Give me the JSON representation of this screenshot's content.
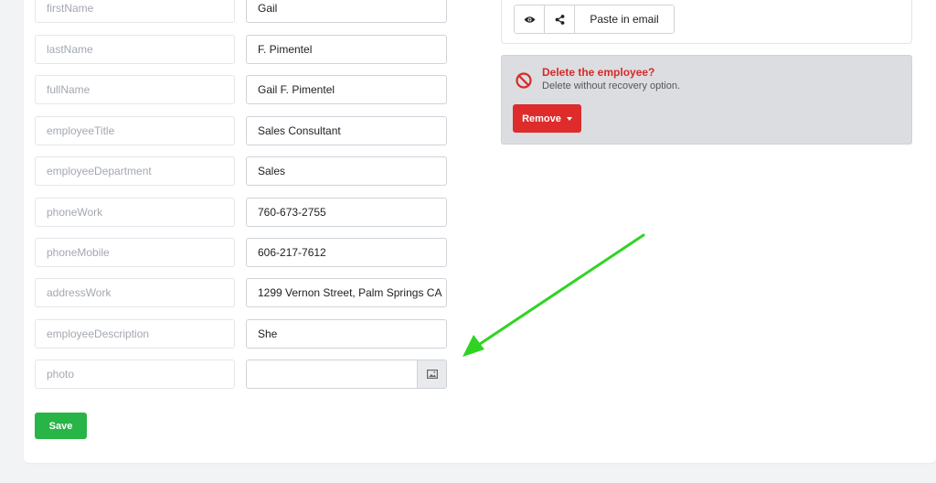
{
  "form": {
    "rows": [
      {
        "key": "firstName",
        "value": "Gail"
      },
      {
        "key": "lastName",
        "value": "F. Pimentel"
      },
      {
        "key": "fullName",
        "value": "Gail F. Pimentel"
      },
      {
        "key": "employeeTitle",
        "value": "Sales Consultant"
      },
      {
        "key": "employeeDepartment",
        "value": "Sales"
      },
      {
        "key": "phoneWork",
        "value": "760-673-2755"
      },
      {
        "key": "phoneMobile",
        "value": "606-217-7612"
      },
      {
        "key": "addressWork",
        "value": "1299 Vernon Street, Palm Springs CA"
      },
      {
        "key": "employeeDescription",
        "value": "She"
      }
    ],
    "photo": {
      "key": "photo",
      "value": "",
      "button_icon": "image-icon"
    },
    "save_label": "Save"
  },
  "share": {
    "view_icon": "eye-icon",
    "share_icon": "share-icon",
    "paste_label": "Paste in email"
  },
  "danger": {
    "icon": "ban-icon",
    "title": "Delete the employee?",
    "description": "Delete without recovery option.",
    "remove_label": "Remove",
    "caret_icon": "caret-down-icon"
  },
  "annotation": {
    "icon": "arrow-icon",
    "color": "#2fd422"
  },
  "colors": {
    "save": "#28b446",
    "danger": "#de2b2b",
    "danger_title": "#d62a2a"
  }
}
